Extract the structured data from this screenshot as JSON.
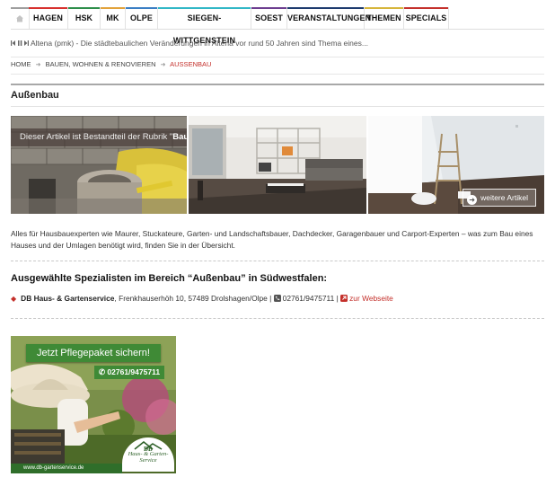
{
  "nav": {
    "home_icon": "home-icon",
    "items": [
      {
        "label": "HAGEN",
        "color": "#d7302d"
      },
      {
        "label": "HSK",
        "color": "#2d8e4a"
      },
      {
        "label": "MK",
        "color": "#e2a23a"
      },
      {
        "label": "OLPE",
        "color": "#3a7ec4"
      },
      {
        "label": "SIEGEN-WITTGENSTEIN",
        "color": "#31b7c6"
      },
      {
        "label": "SOEST",
        "color": "#6c3d8f"
      },
      {
        "label": "VERANSTALTUNGEN",
        "color": "#1d3a6e"
      },
      {
        "label": "THEMEN",
        "color": "#d6b53a"
      },
      {
        "label": "SPECIALS",
        "color": "#c4302b"
      }
    ]
  },
  "ticker": {
    "text": "Altena (pmk) - Die städtebaulichen Veränderungen in Altena vor rund 50 Jahren sind Thema eines..."
  },
  "breadcrumb": {
    "items": [
      "HOME",
      "BAUEN, WOHNEN & RENOVIEREN"
    ],
    "current": "AUSSENBAU",
    "separator": "➜"
  },
  "page": {
    "title": "Außenbau"
  },
  "hero": {
    "caption_prefix": "Dieser Artikel ist Bestandteil der Rubrik \"",
    "caption_rubric": "Bauen, Wohnen & Renovieren",
    "caption_suffix": "\"",
    "more_button": "weitere Artikel"
  },
  "intro": {
    "text": "Alles für Hausbauexperten wie Maurer, Stuckateure, Garten- und Landschaftsbauer, Dachdecker, Garagenbauer und Carport-Experten – was zum Bau eines Hauses und der Umlagen benötigt wird, finden Sie in der Übersicht."
  },
  "specialists": {
    "heading": "Ausgewählte Spezialisten im Bereich “Außenbau” in Südwestfalen:",
    "items": [
      {
        "name": "DB Haus- & Gartenservice",
        "address": ", Frenkhauserhöh 10, 57489 Drolshagen/Olpe | ",
        "phone": "02761/9475711",
        "divider": " | ",
        "link_label": "zur Webseite"
      }
    ]
  },
  "ad": {
    "headline": "Jetzt Pflegepaket sichern!",
    "phone": "02761/9475711",
    "url": "www.db-gartenservice.de",
    "logo_initials": "DB",
    "logo_line1": "Haus- & Garten-",
    "logo_line2": "Service"
  }
}
